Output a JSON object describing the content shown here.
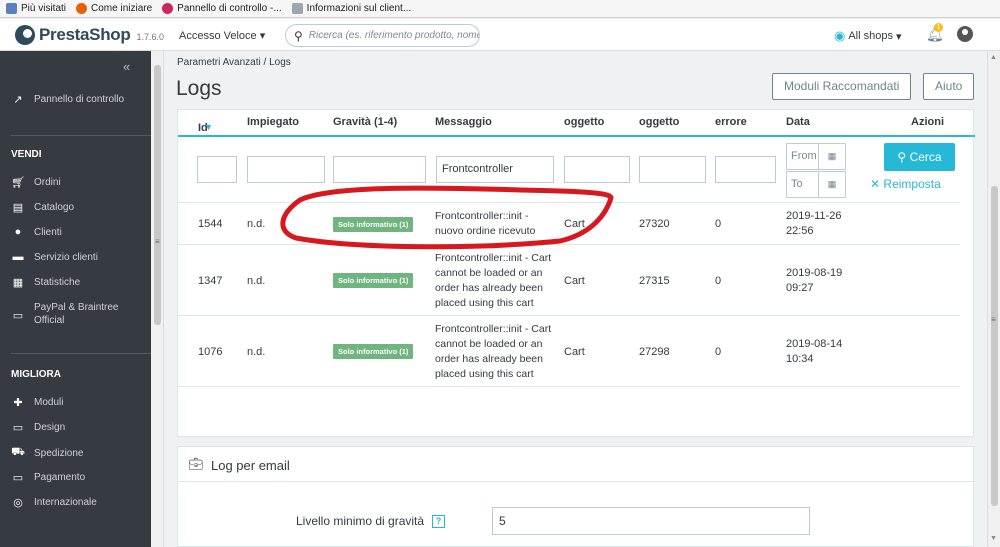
{
  "bookmarks": [
    {
      "label": "Più visitati",
      "icon": "bookmark-icon",
      "color": "#5b7fbf"
    },
    {
      "label": "Come iniziare",
      "icon": "firefox-icon",
      "color": "#e66000"
    },
    {
      "label": "Pannello di controllo -...",
      "icon": "prestashop-tab-icon",
      "color": "#d0245f"
    },
    {
      "label": "Informazioni sul client...",
      "icon": "page-icon",
      "color": "#9aa7b0"
    }
  ],
  "header": {
    "brand": "PrestaShop",
    "version": "1.7.6.0",
    "quick_access": "Accesso Veloce",
    "search_placeholder": "Ricerca (es. riferimento prodotto, nome",
    "shops": "All shops",
    "notifications": "1"
  },
  "sidebar": {
    "top_item": "Pannello di controllo",
    "sections": [
      {
        "title": "VENDI",
        "items": [
          "Ordini",
          "Catalogo",
          "Clienti",
          "Servizio clienti",
          "Statistiche",
          "PayPal & Braintree Official"
        ]
      },
      {
        "title": "MIGLIORA",
        "items": [
          "Moduli",
          "Design",
          "Spedizione",
          "Pagamento",
          "Internazionale"
        ]
      }
    ]
  },
  "page": {
    "breadcrumb": "Parametri Avanzati  /  Logs",
    "title": "Logs",
    "btn_modules": "Moduli Raccomandati",
    "btn_help": "Aiuto"
  },
  "table": {
    "columns": [
      "Id",
      "Impiegato",
      "Gravità (1-4)",
      "Messaggio",
      "oggetto",
      "oggetto",
      "errore",
      "Data",
      "Azioni"
    ],
    "filter": {
      "message": "Frontcontroller",
      "date_from": "From",
      "date_to": "To",
      "search_btn": "Cerca",
      "reset_btn": "Reimposta"
    },
    "rows": [
      {
        "id": "1544",
        "employee": "n.d.",
        "severity": "Solo informativo (1)",
        "message": "Frontcontroller::init - nuovo ordine ricevuto",
        "object_type": "Cart",
        "object_id": "27320",
        "error": "0",
        "date": "2019-11-26",
        "time": "22:56"
      },
      {
        "id": "1347",
        "employee": "n.d.",
        "severity": "Solo informativo (1)",
        "message": "Frontcontroller::init - Cart cannot be loaded or an order has already been placed using this cart",
        "object_type": "Cart",
        "object_id": "27315",
        "error": "0",
        "date": "2019-08-19",
        "time": "09:27"
      },
      {
        "id": "1076",
        "employee": "n.d.",
        "severity": "Solo informativo (1)",
        "message": "Frontcontroller::init - Cart cannot be loaded or an order has already been placed using this cart",
        "object_type": "Cart",
        "object_id": "27298",
        "error": "0",
        "date": "2019-08-14",
        "time": "10:34"
      }
    ]
  },
  "email_panel": {
    "title": "Log per email",
    "label": "Livello minimo di gravità",
    "help": "?",
    "value": "5"
  },
  "colors": {
    "accent": "#25b9d7",
    "badge": "#70b580",
    "sidebar": "#363a41",
    "annotation": "#d8181f"
  }
}
